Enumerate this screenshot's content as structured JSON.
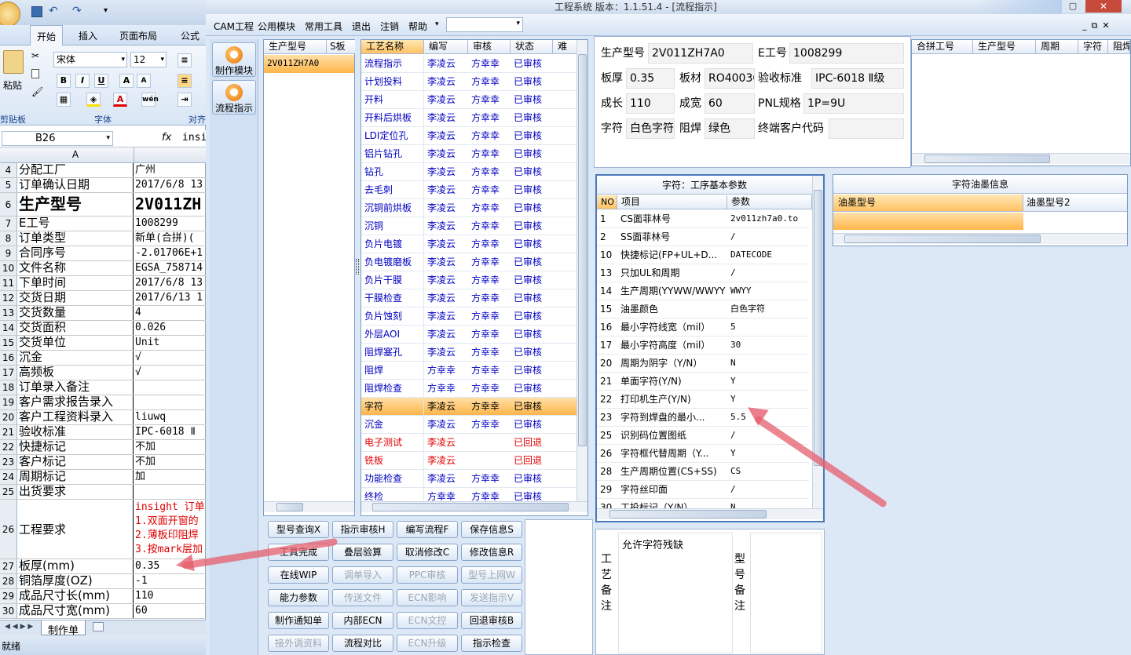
{
  "excel": {
    "tabs": [
      "开始",
      "插入",
      "页面布局",
      "公式"
    ],
    "ribbon": {
      "font_name": "宋体",
      "font_size": "12",
      "paste": "粘贴",
      "groups": [
        "剪贴板",
        "字体",
        "对齐"
      ]
    },
    "name_box": "B26",
    "fx": "fx",
    "formula": "insi",
    "col_a": "A",
    "rows": [
      {
        "n": "4",
        "a": "分配工厂",
        "b": "广州"
      },
      {
        "n": "5",
        "a": "订单确认日期",
        "b": "2017/6/8 13"
      },
      {
        "n": "6",
        "a": "生产型号",
        "b": "2V011ZH"
      },
      {
        "n": "7",
        "a": "E工号",
        "b": "1008299"
      },
      {
        "n": "8",
        "a": "订单类型",
        "b": "新单(合拼)("
      },
      {
        "n": "9",
        "a": "合同序号",
        "b": "-2.01706E+1"
      },
      {
        "n": "10",
        "a": "文件名称",
        "b": "EGSA_758714"
      },
      {
        "n": "11",
        "a": "下单时间",
        "b": "2017/6/8 13"
      },
      {
        "n": "12",
        "a": "交货日期",
        "b": "2017/6/13 1"
      },
      {
        "n": "13",
        "a": "交货数量",
        "b": "4"
      },
      {
        "n": "14",
        "a": "交货面积",
        "b": "0.026"
      },
      {
        "n": "15",
        "a": "交货单位",
        "b": "Unit"
      },
      {
        "n": "16",
        "a": "沉金",
        "b": "√"
      },
      {
        "n": "17",
        "a": "高频板",
        "b": "√"
      },
      {
        "n": "18",
        "a": "订单录入备注",
        "b": ""
      },
      {
        "n": "19",
        "a": "客户需求报告录入",
        "b": ""
      },
      {
        "n": "20",
        "a": "客户工程资料录入",
        "b": "liuwq"
      },
      {
        "n": "21",
        "a": "验收标准",
        "b": "IPC-6018 Ⅱ"
      },
      {
        "n": "22",
        "a": "快捷标记",
        "b": "不加"
      },
      {
        "n": "23",
        "a": "客户标记",
        "b": "不加"
      },
      {
        "n": "24",
        "a": "周期标记",
        "b": "加"
      },
      {
        "n": "25",
        "a": "出货要求",
        "b": ""
      },
      {
        "n": "26",
        "a": "工程要求",
        "b": ""
      },
      {
        "n": "27",
        "a": "板厚(mm)",
        "b": "0.35"
      },
      {
        "n": "28",
        "a": "铜箔厚度(OZ)",
        "b": "-1"
      },
      {
        "n": "29",
        "a": "成品尺寸长(mm)",
        "b": "110"
      },
      {
        "n": "30",
        "a": "成品尺寸宽(mm)",
        "b": "60"
      }
    ],
    "eng_req": [
      "insight 订单",
      "1.双面开窗的",
      "2.薄板印阻焊",
      "3.按mark层加"
    ],
    "sheet_tab": "制作单",
    "status": "就绪"
  },
  "app": {
    "title": "工程系统  版本：1.1.51.4 - [流程指示]",
    "menu": [
      "CAM工程",
      "公用模块",
      "常用工具",
      "退出",
      "注销",
      "帮助"
    ],
    "nav": [
      {
        "label": "制作模块"
      },
      {
        "label": "流程指示"
      }
    ],
    "model_list": {
      "headers": [
        "生产型号",
        "S板"
      ],
      "items": [
        "2V011ZH7A0"
      ]
    },
    "process": {
      "headers": [
        "工艺名称",
        "编写",
        "审核",
        "状态",
        "难"
      ],
      "rows": [
        {
          "name": "流程指示",
          "writer": "李凌云",
          "reviewer": "方幸幸",
          "status": "已审核"
        },
        {
          "name": "计划投料",
          "writer": "李凌云",
          "reviewer": "方幸幸",
          "status": "已审核"
        },
        {
          "name": "开料",
          "writer": "李凌云",
          "reviewer": "方幸幸",
          "status": "已审核"
        },
        {
          "name": "开料后烘板",
          "writer": "李凌云",
          "reviewer": "方幸幸",
          "status": "已审核"
        },
        {
          "name": "LDI定位孔",
          "writer": "李凌云",
          "reviewer": "方幸幸",
          "status": "已审核"
        },
        {
          "name": "铝片钻孔",
          "writer": "李凌云",
          "reviewer": "方幸幸",
          "status": "已审核"
        },
        {
          "name": "钻孔",
          "writer": "李凌云",
          "reviewer": "方幸幸",
          "status": "已审核"
        },
        {
          "name": "去毛刺",
          "writer": "李凌云",
          "reviewer": "方幸幸",
          "status": "已审核"
        },
        {
          "name": "沉铜前烘板",
          "writer": "李凌云",
          "reviewer": "方幸幸",
          "status": "已审核"
        },
        {
          "name": "沉铜",
          "writer": "李凌云",
          "reviewer": "方幸幸",
          "status": "已审核"
        },
        {
          "name": "负片电镀",
          "writer": "李凌云",
          "reviewer": "方幸幸",
          "status": "已审核"
        },
        {
          "name": "负电镀磨板",
          "writer": "李凌云",
          "reviewer": "方幸幸",
          "status": "已审核"
        },
        {
          "name": "负片干膜",
          "writer": "李凌云",
          "reviewer": "方幸幸",
          "status": "已审核"
        },
        {
          "name": "干膜检查",
          "writer": "李凌云",
          "reviewer": "方幸幸",
          "status": "已审核"
        },
        {
          "name": "负片蚀刻",
          "writer": "李凌云",
          "reviewer": "方幸幸",
          "status": "已审核"
        },
        {
          "name": "外层AOI",
          "writer": "李凌云",
          "reviewer": "方幸幸",
          "status": "已审核"
        },
        {
          "name": "阻焊塞孔",
          "writer": "李凌云",
          "reviewer": "方幸幸",
          "status": "已审核"
        },
        {
          "name": "阻焊",
          "writer": "方幸幸",
          "reviewer": "方幸幸",
          "status": "已审核"
        },
        {
          "name": "阻焊检查",
          "writer": "方幸幸",
          "reviewer": "方幸幸",
          "status": "已审核"
        },
        {
          "name": "字符",
          "writer": "李凌云",
          "reviewer": "方幸幸",
          "status": "已审核"
        },
        {
          "name": "沉金",
          "writer": "李凌云",
          "reviewer": "方幸幸",
          "status": "已审核"
        },
        {
          "name": "电子测试",
          "writer": "李凌云",
          "reviewer": "",
          "status": "已回退"
        },
        {
          "name": "铣板",
          "writer": "李凌云",
          "reviewer": "",
          "status": "已回退"
        },
        {
          "name": "功能检查",
          "writer": "李凌云",
          "reviewer": "方幸幸",
          "status": "已审核"
        },
        {
          "name": "终检",
          "writer": "方幸幸",
          "reviewer": "方幸幸",
          "status": "已审核"
        }
      ]
    },
    "buttons": [
      [
        "型号查询X",
        "指示审核H",
        "编写流程F",
        "保存信息S"
      ],
      [
        "工具完成",
        "叠层验算",
        "取消修改C",
        "修改信息R"
      ],
      [
        "在线WIP",
        "调单导入",
        "PPC审核",
        "型号上网W"
      ],
      [
        "能力参数",
        "传送文件",
        "ECN影响",
        "发送指示V"
      ],
      [
        "制作通知单",
        "内部ECN",
        "ECN文控",
        "回退审核B"
      ],
      [
        "接外调资料",
        "流程对比",
        "ECN升级",
        "指示检查"
      ]
    ],
    "info": {
      "model_lbl": "生产型号",
      "model": "2V011ZH7A0",
      "e_lbl": "E工号",
      "e": "1008299",
      "thick_lbl": "板厚",
      "thick": "0.35",
      "mat_lbl": "板材",
      "mat": "RO4003C",
      "std_lbl": "验收标准",
      "std": "IPC-6018 Ⅱ级",
      "len_lbl": "成长",
      "len": "110",
      "wid_lbl": "成宽",
      "wid": "60",
      "pnl_lbl": "PNL规格",
      "pnl": "1P=9U",
      "char_lbl": "字符",
      "char": "白色字符",
      "mask_lbl": "阻焊",
      "mask": "绿色",
      "cust_lbl": "终端客户代码",
      "cust": ""
    },
    "merge": {
      "headers": [
        "合拼工号",
        "生产型号",
        "周期",
        "字符",
        "阻焊"
      ]
    },
    "params": {
      "title": "字符：工序基本参数",
      "headers": [
        "NO",
        "项目",
        "参数"
      ],
      "rows": [
        {
          "no": "1",
          "item": "CS面菲林号",
          "val": "2v011zh7a0.to"
        },
        {
          "no": "2",
          "item": "SS面菲林号",
          "val": "/"
        },
        {
          "no": "10",
          "item": "快捷标记(FP+UL+D...",
          "val": "DATECODE"
        },
        {
          "no": "13",
          "item": "只加UL和周期",
          "val": "/"
        },
        {
          "no": "14",
          "item": "生产周期(YYWW/WWYY)",
          "val": "WWYY"
        },
        {
          "no": "15",
          "item": "油墨颜色",
          "val": "白色字符"
        },
        {
          "no": "16",
          "item": "最小字符线宽（mil）",
          "val": "5"
        },
        {
          "no": "17",
          "item": "最小字符高度（mil）",
          "val": "30"
        },
        {
          "no": "20",
          "item": "周期为阴字（Y/N）",
          "val": "N"
        },
        {
          "no": "21",
          "item": "单面字符(Y/N)",
          "val": "Y"
        },
        {
          "no": "22",
          "item": "打印机生产(Y/N)",
          "val": "Y"
        },
        {
          "no": "23",
          "item": "字符到焊盘的最小...",
          "val": "5.5"
        },
        {
          "no": "25",
          "item": "识别码位置图纸",
          "val": "/"
        },
        {
          "no": "26",
          "item": "字符框代替周期（Y...",
          "val": "Y"
        },
        {
          "no": "28",
          "item": "生产周期位置(CS+SS)",
          "val": "CS"
        },
        {
          "no": "29",
          "item": "字符丝印面",
          "val": "/"
        },
        {
          "no": "30",
          "item": "工投标记（Y/N）",
          "val": "N"
        }
      ]
    },
    "ink": {
      "title": "字符油墨信息",
      "headers": [
        "油墨型号",
        "油墨型号2"
      ]
    },
    "process_note": {
      "label": "工艺备注",
      "text": "允许字符残缺"
    },
    "model_note": {
      "label": "型号备注",
      "text": ""
    },
    "colors": {
      "accent": "#ffb54a",
      "blue_text": "#0000c0",
      "red_text": "#e00000",
      "arrow": "#e65f6e"
    }
  }
}
